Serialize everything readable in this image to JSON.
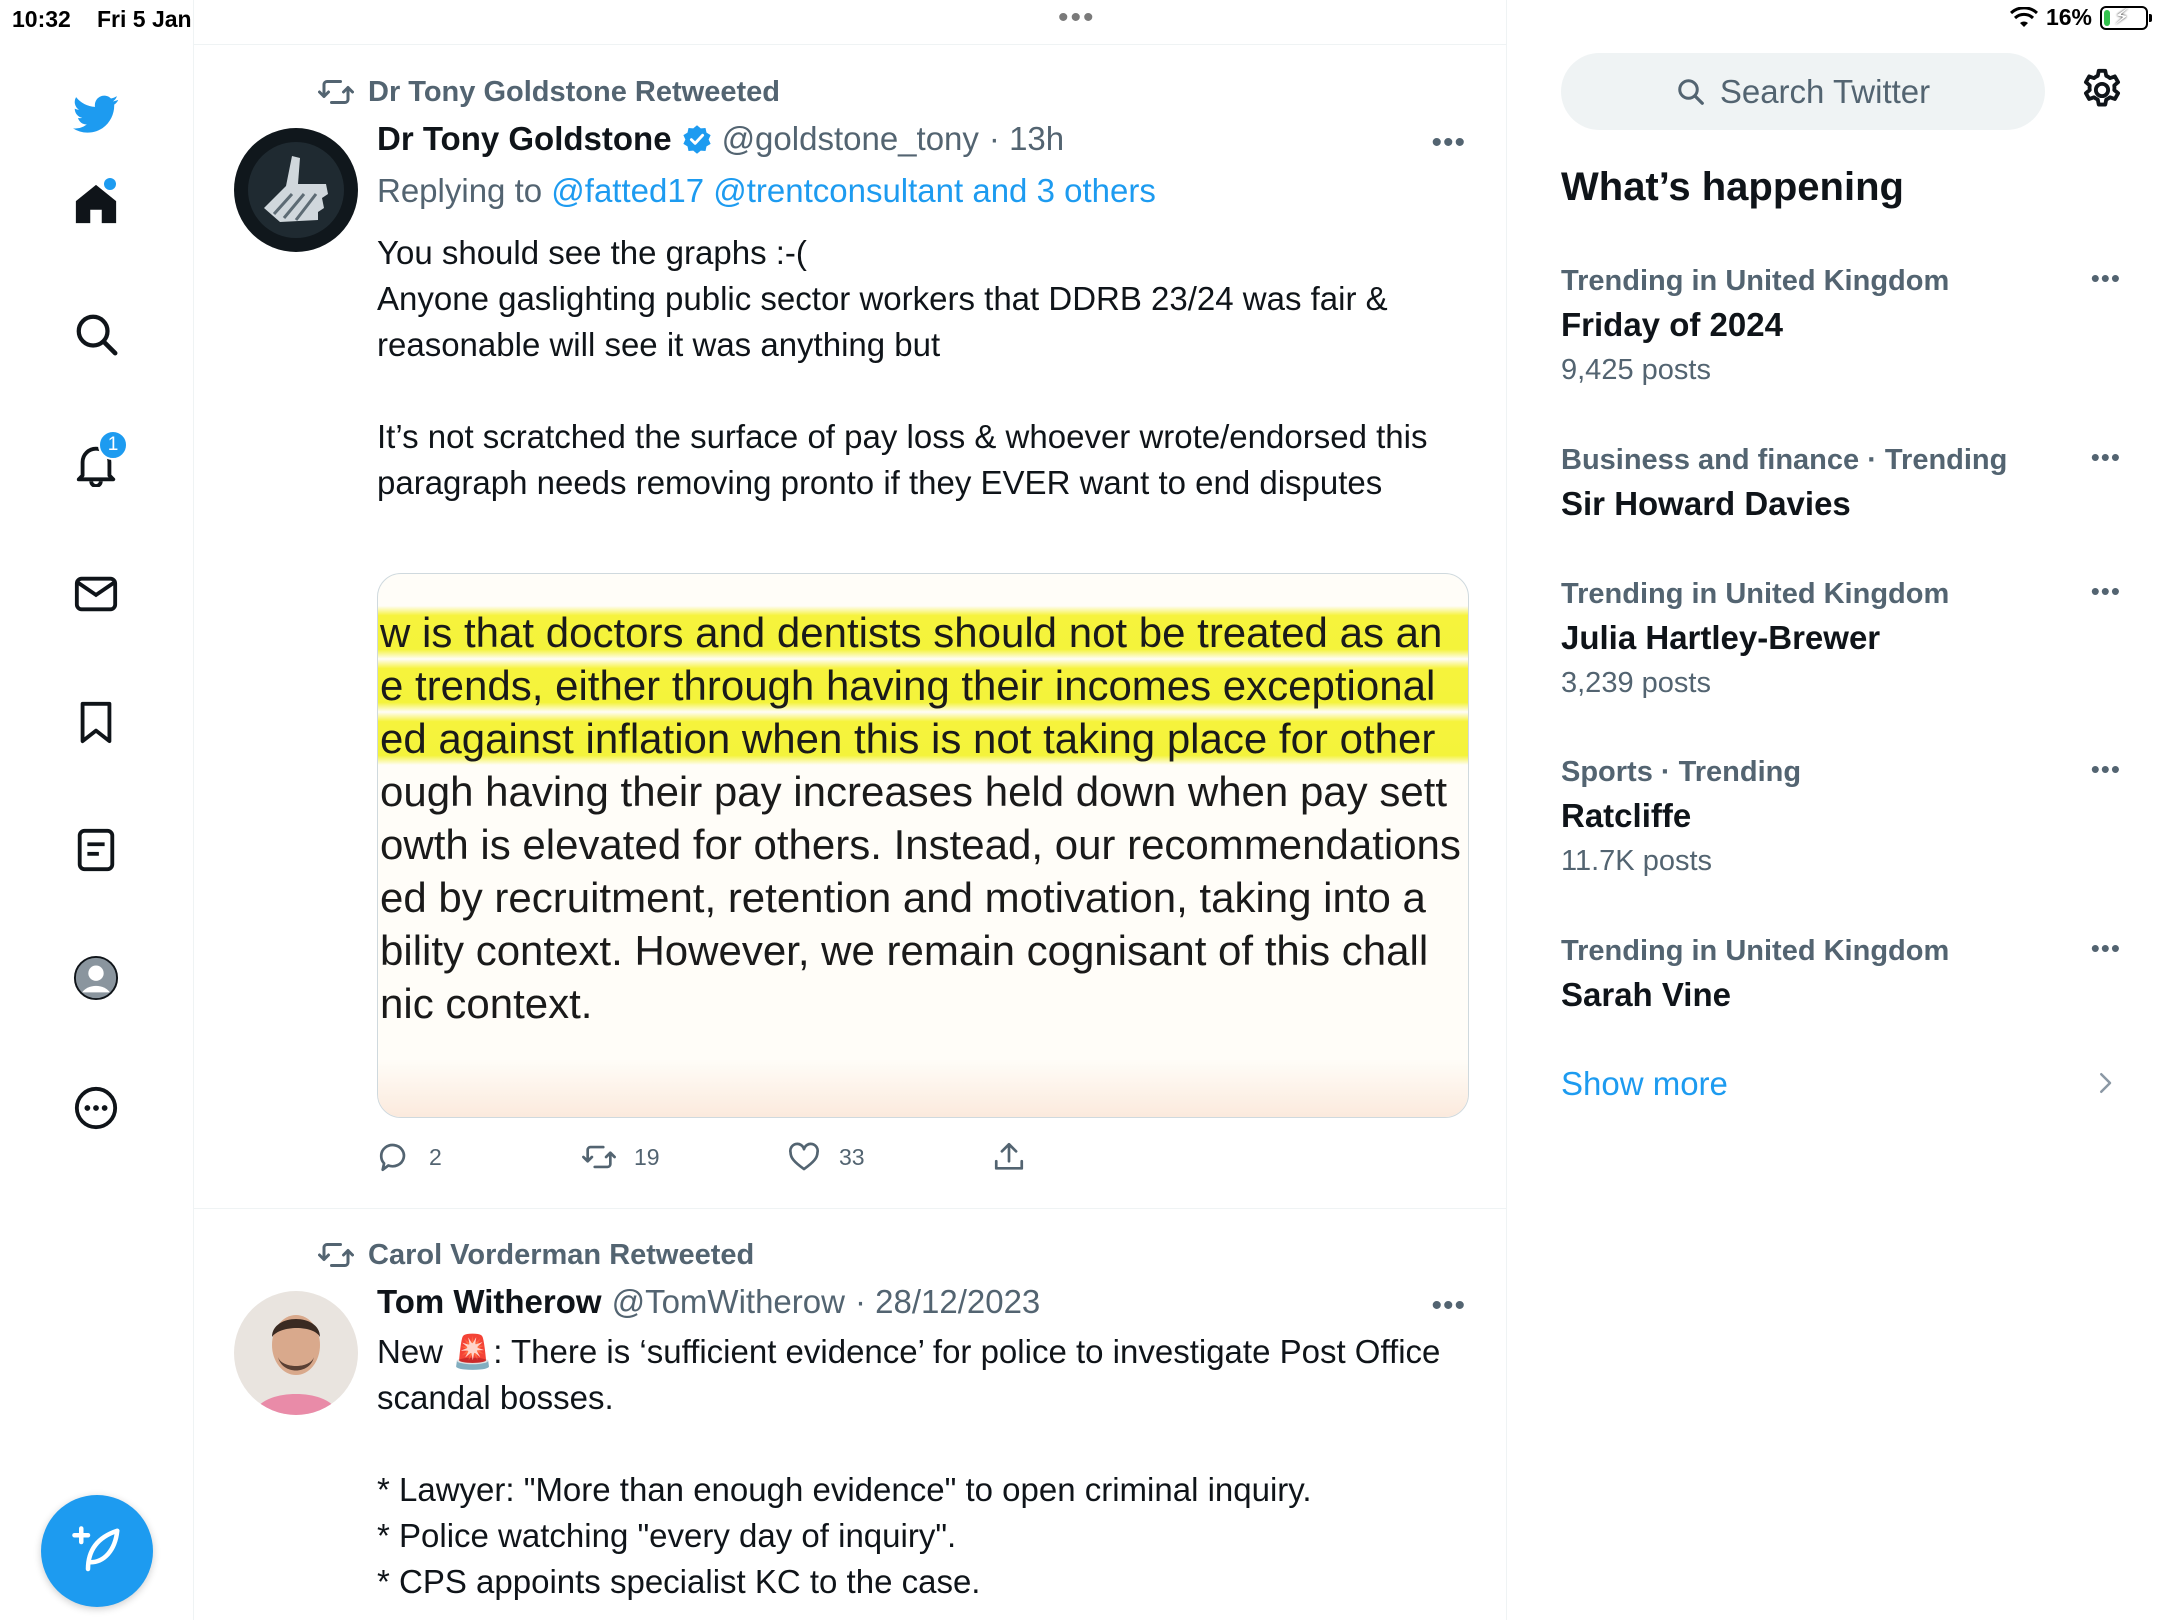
{
  "status_bar": {
    "time": "10:32",
    "date": "Fri 5 Jan",
    "battery_percent": "16%",
    "battery_level": 0.16,
    "multitask_dots": "•••"
  },
  "nav": {
    "notifications_badge": "1",
    "items": [
      "twitter-logo-icon",
      "home-icon",
      "search-icon",
      "bell-icon",
      "mail-icon",
      "bookmark-icon",
      "lists-icon",
      "profile-icon",
      "more-icon"
    ]
  },
  "tweets": [
    {
      "retweeted_by": "Dr Tony Goldstone Retweeted",
      "name": "Dr Tony Goldstone",
      "handle": "@goldstone_tony",
      "time": "· 13h",
      "verified": true,
      "replying_prefix": "Replying to",
      "replying_to": "@fatted17 @trentconsultant and 3 others",
      "text": "You should see the graphs :-(\nAnyone gaslighting public sector workers that DDRB 23/24 was fair & reasonable will see it was anything but\n\nIt’s not scratched the surface of pay loss & whoever wrote/endorsed this paragraph needs removing pronto if they EVER want to end disputes",
      "media_lines": [
        "w is that doctors and dentists should not be treated as an",
        "e trends, either through having their incomes exceptional",
        "ed against inflation when this is not taking place for other",
        "ough having their pay increases held down when pay sett",
        "owth is elevated for others. Instead, our recommendations",
        "ed by recruitment, retention and motivation, taking into a",
        "bility context. However, we remain cognisant of this chall",
        "nic context."
      ],
      "replies": "2",
      "retweets": "19",
      "likes": "33"
    },
    {
      "retweeted_by": "Carol Vorderman Retweeted",
      "name": "Tom Witherow",
      "handle": "@TomWitherow",
      "time": "· 28/12/2023",
      "text_before_emoji": "New ",
      "emoji": "🚨",
      "text_after_emoji": ": There is ‘sufficient evidence’ for police to investigate Post Office scandal bosses.",
      "bullets": "* Lawyer: \"More than enough evidence\" to open criminal inquiry.\n* Police watching \"every day of inquiry\".\n* CPS appoints specialist KC to the case."
    }
  ],
  "sidebar": {
    "search_placeholder": "Search Twitter",
    "whats_happening": "What’s happening",
    "trends": [
      {
        "context": "Trending in United Kingdom",
        "name": "Friday of 2024",
        "count": "9,425 posts"
      },
      {
        "context": "Business and finance · Trending",
        "name": "Sir Howard Davies",
        "count": ""
      },
      {
        "context": "Trending in United Kingdom",
        "name": "Julia Hartley-Brewer",
        "count": "3,239 posts"
      },
      {
        "context": "Sports · Trending",
        "name": "Ratcliffe",
        "count": "11.7K posts"
      },
      {
        "context": "Trending in United Kingdom",
        "name": "Sarah Vine",
        "count": ""
      }
    ],
    "show_more": "Show more"
  },
  "colors": {
    "accent": "#1d9bf0",
    "secondary_text": "#536471",
    "primary_text": "#0f1419",
    "highlight": "#f4f33b"
  }
}
